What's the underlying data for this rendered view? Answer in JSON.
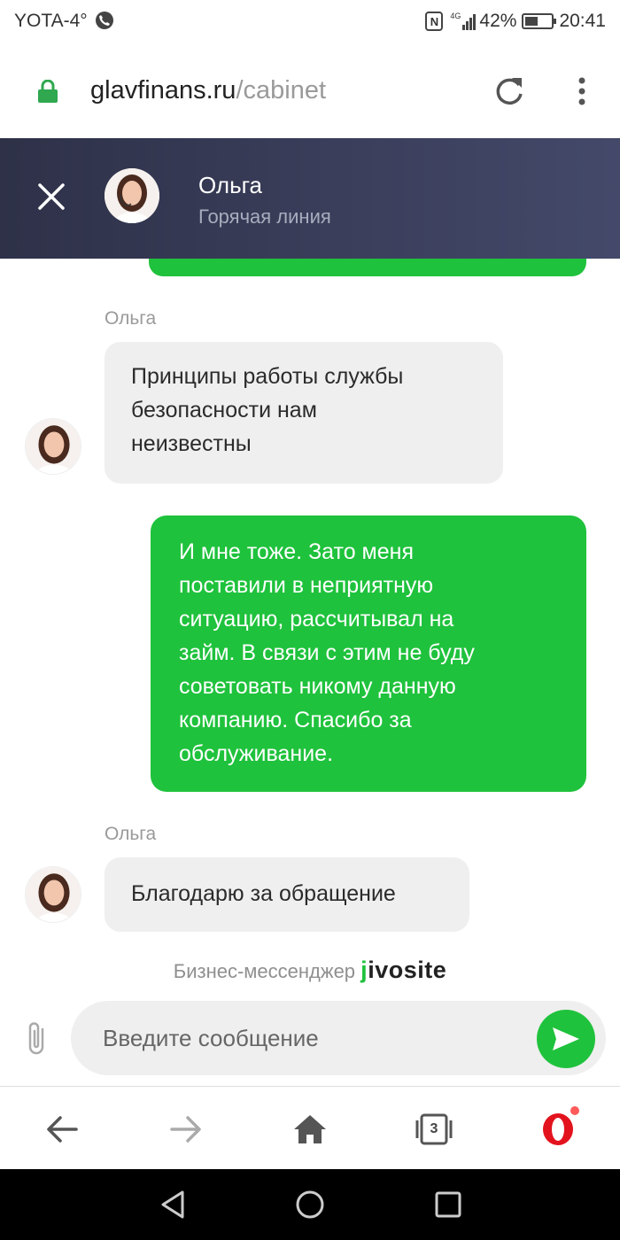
{
  "status_bar": {
    "carrier": "YOTA-4°",
    "network": "4G",
    "battery": "42%",
    "battery_level": 0.42,
    "time": "20:41"
  },
  "browser": {
    "url_domain": "glavfinans.ru",
    "url_path": "/cabinet"
  },
  "chat_header": {
    "agent_name": "Ольга",
    "agent_role": "Горячая линия"
  },
  "messages": [
    {
      "sender": "Ольга",
      "direction": "incoming",
      "lines": [
        "Принципы работы службы",
        "безопасности нам",
        "неизвестны"
      ]
    },
    {
      "direction": "outgoing",
      "lines": [
        "И мне тоже. Зато меня",
        "поставили в неприятную",
        "ситуацию, рассчитывал на",
        "займ. В связи с этим не буду",
        "советовать никому данную",
        "компанию. Спасибо за",
        "обслуживание."
      ]
    },
    {
      "sender": "Ольга",
      "direction": "incoming",
      "lines": [
        "Благодарю за обращение"
      ]
    }
  ],
  "branding": {
    "label": "Бизнес-мессенджер",
    "brand_prefix": "j",
    "brand_rest": "ivosite"
  },
  "input": {
    "placeholder": "Введите сообщение"
  },
  "bottom_nav": {
    "tabs_count": "3"
  },
  "colors": {
    "accent_green": "#1fc23c",
    "header_bg": "#383c58",
    "bubble_incoming": "#efefef"
  }
}
